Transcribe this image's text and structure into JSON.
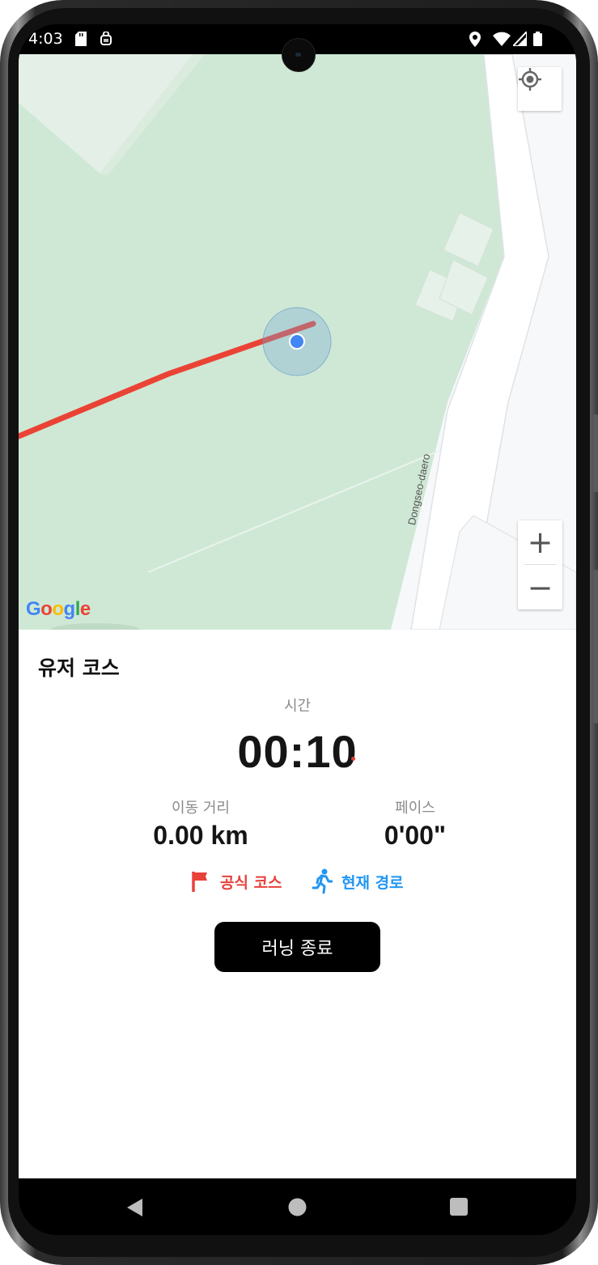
{
  "status_bar": {
    "time": "4:03",
    "icons": [
      "sd-card-icon",
      "sync-icon",
      "location-icon",
      "wifi-icon",
      "signal-icon",
      "battery-icon"
    ]
  },
  "map": {
    "road_label": "Dongseo-daero",
    "attribution": [
      "G",
      "o",
      "o",
      "g",
      "l",
      "e"
    ],
    "attribution_colors": [
      "#4285F4",
      "#EA4335",
      "#FBBC05",
      "#4285F4",
      "#34A853",
      "#EA4335"
    ],
    "zoom_in": "+",
    "zoom_out": "−",
    "route_color": "#EA4335",
    "location_dot_color": "#4285F4"
  },
  "panel": {
    "course_title": "유저 코스",
    "time_label": "시간",
    "time_value": "00:10",
    "distance_label": "이동 거리",
    "distance_value": "0.00 km",
    "pace_label": "페이스",
    "pace_value": "0'00\"",
    "legend_official": "공식 코스",
    "legend_current": "현재 경로",
    "official_color": "#E8413A",
    "current_color": "#2196F3",
    "stop_button": "러닝 종료"
  }
}
